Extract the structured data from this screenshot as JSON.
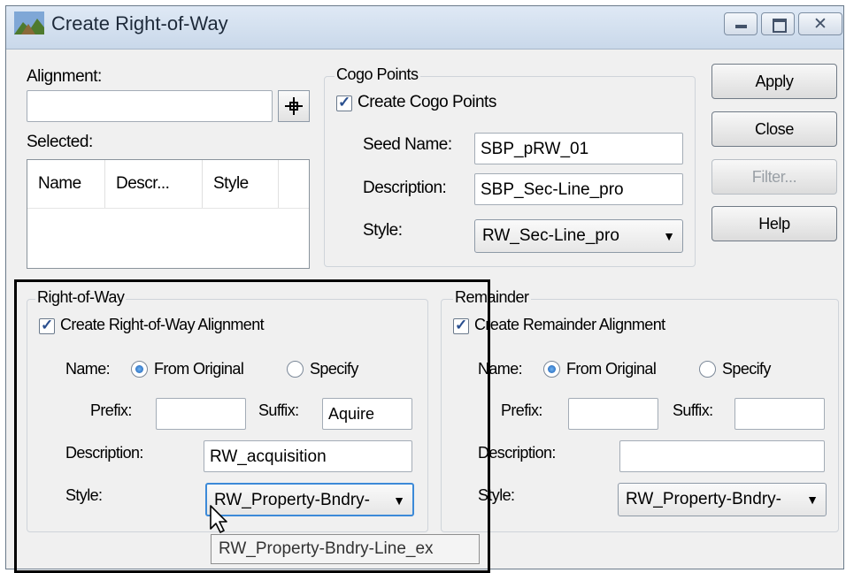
{
  "window": {
    "title": "Create Right-of-Way"
  },
  "alignment": {
    "label": "Alignment:",
    "value": "",
    "pick_icon": "crosshair-pick-icon"
  },
  "selected": {
    "label": "Selected:",
    "columns": [
      "Name",
      "Descr...",
      "Style"
    ]
  },
  "cogo": {
    "group_label": "Cogo Points",
    "create_label": "Create Cogo Points",
    "create_checked": true,
    "seed_label": "Seed Name:",
    "seed_value": "SBP_pRW_01",
    "desc_label": "Description:",
    "desc_value": "SBP_Sec-Line_pro",
    "style_label": "Style:",
    "style_value": "RW_Sec-Line_pro"
  },
  "buttons": {
    "apply": "Apply",
    "close": "Close",
    "filter": "Filter...",
    "help": "Help"
  },
  "row": {
    "group_label": "Right-of-Way",
    "create_label": "Create Right-of-Way Alignment",
    "create_checked": true,
    "name_label": "Name:",
    "from_original": "From Original",
    "specify": "Specify",
    "name_choice": "from_original",
    "prefix_label": "Prefix:",
    "prefix_value": "",
    "suffix_label": "Suffix:",
    "suffix_value": "Aquire",
    "desc_label": "Description:",
    "desc_value": "RW_acquisition",
    "style_label": "Style:",
    "style_value": "RW_Property-Bndry-"
  },
  "remainder": {
    "group_label": "Remainder",
    "create_label": "Create Remainder Alignment",
    "create_checked": true,
    "name_label": "Name:",
    "from_original": "From Original",
    "specify": "Specify",
    "name_choice": "from_original",
    "prefix_label": "Prefix:",
    "prefix_value": "",
    "suffix_label": "Suffix:",
    "suffix_value": "",
    "desc_label": "Description:",
    "desc_value": "",
    "style_label": "Style:",
    "style_value": "RW_Property-Bndry-"
  },
  "tooltip": {
    "text": "RW_Property-Bndry-Line_ex"
  },
  "colors": {
    "highlight_box": "#000000",
    "radio_selected": "#1a5fb4",
    "title_bar": "#c9d8ea"
  }
}
